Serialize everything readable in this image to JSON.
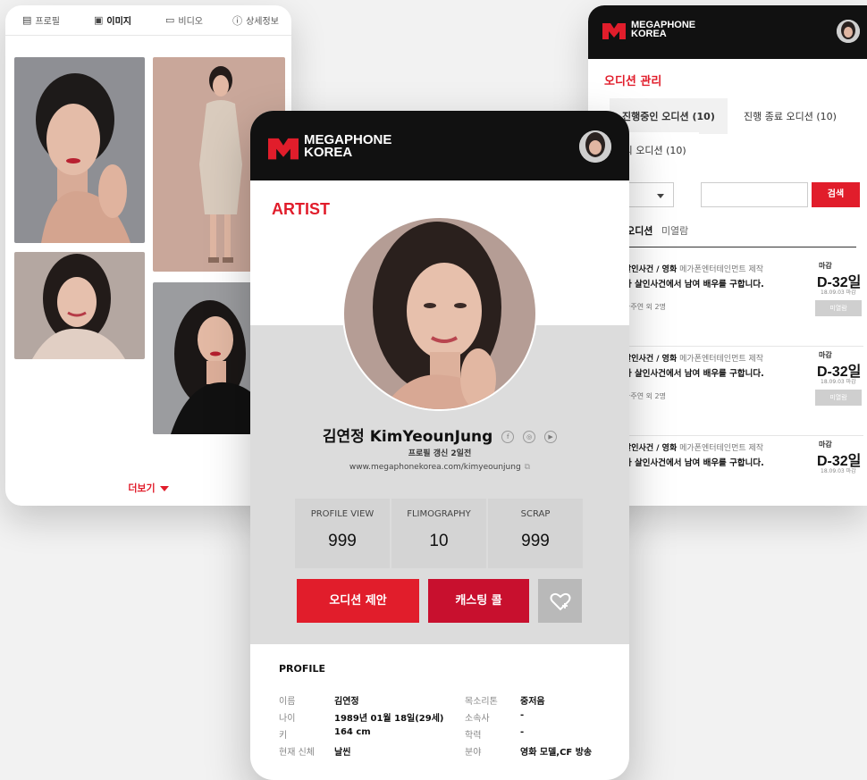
{
  "left_card": {
    "tabs": [
      {
        "label": "프로필",
        "icon": "profile-icon"
      },
      {
        "label": "이미지",
        "icon": "image-icon",
        "active": true
      },
      {
        "label": "비디오",
        "icon": "video-icon"
      },
      {
        "label": "상세정보",
        "icon": "info-icon"
      }
    ],
    "more_label": "더보기"
  },
  "brand": {
    "line1": "MEGAPHONE",
    "line2": "KOREA",
    "accent": "#e11d2b"
  },
  "right_card": {
    "title": "오디션 관리",
    "tabs": [
      "진행중인 오디션 (10)",
      "진행 종료 오디션 (10)",
      "그 외 오디션 (10)"
    ],
    "select_value": "람",
    "search_label": "검색",
    "list_title": "중인 오디션",
    "list_sub": "미열람",
    "auditions": [
      {
        "category": "살인사건 / 영화",
        "company": "메가폰엔터테인먼트 제작",
        "title": "라 살인사건에서 남여 배우를 구합니다.",
        "meta": "자주연 외 2명",
        "deadline_label": "마감",
        "dday": "D-32일",
        "date": "18.09.03 마감",
        "status": "미열람"
      },
      {
        "category": "살인사건 / 영화",
        "company": "메가폰엔터테인먼트 제작",
        "title": "라 살인사건에서 남여 배우를 구합니다.",
        "meta": "자주연 외 2명",
        "deadline_label": "마감",
        "dday": "D-32일",
        "date": "18.09.03 마감",
        "status": "미열람"
      },
      {
        "category": "살인사건 / 영화",
        "company": "메가폰엔터테인먼트 제작",
        "title": "라 살인사건에서 남여 배우를 구합니다.",
        "meta": "자주연 외 2명",
        "deadline_label": "마감",
        "dday": "D-32일",
        "date": "18.09.03 마감",
        "status": ""
      }
    ]
  },
  "center_card": {
    "section": "ARTIST",
    "name": "김연정 KimYeounJung",
    "social": [
      "f",
      "◎",
      "▶"
    ],
    "updated": "프로필 갱신 2일전",
    "url": "www.megaphonekorea.com/kimyeounjung",
    "stats": [
      {
        "label": "PROFILE VIEW",
        "value": "999"
      },
      {
        "label": "FLIMOGRAPHY",
        "value": "10"
      },
      {
        "label": "SCRAP",
        "value": "999"
      }
    ],
    "buttons": {
      "audition": "오디션 제안",
      "casting": "캐스팅 콜",
      "favorite_icon": "heart-plus-icon"
    },
    "profile_title": "PROFILE",
    "profile_left": [
      {
        "k": "이름",
        "v": "김연정"
      },
      {
        "k": "나이",
        "v": "1989년 01월 18일(29세)"
      },
      {
        "k": "키",
        "v": "164 cm"
      },
      {
        "k": "현재 신체",
        "v": "날씬"
      }
    ],
    "profile_right": [
      {
        "k": "목소리톤",
        "v": "중저음"
      },
      {
        "k": "소속사",
        "v": "-"
      },
      {
        "k": "학력",
        "v": "-"
      },
      {
        "k": "분야",
        "v": "영화 모델,CF 방송"
      }
    ]
  }
}
